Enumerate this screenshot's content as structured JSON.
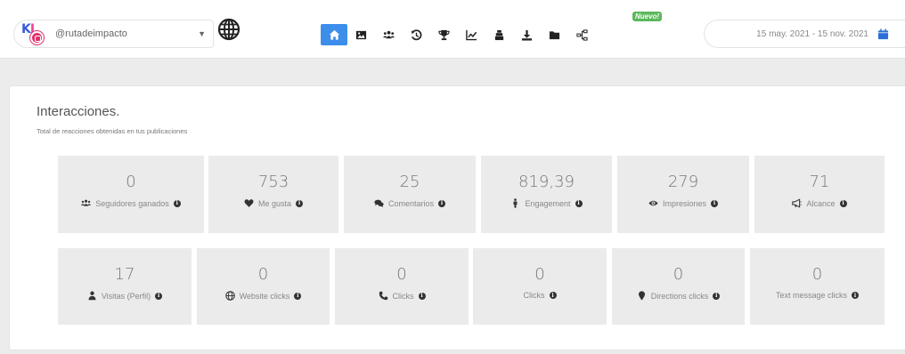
{
  "account": {
    "name": "@rutadeimpacto",
    "logo_text": "KI"
  },
  "nav": {
    "icons": [
      "home-icon",
      "image-icon",
      "users-icon",
      "history-icon",
      "trophy-icon",
      "chart-icon",
      "ranking-icon",
      "download-icon",
      "folder-icon",
      "network-icon"
    ],
    "new_badge": "Nuevo!"
  },
  "date_range": "15 may. 2021 - 15 nov. 2021",
  "section": {
    "title": "Interacciones.",
    "subtitle": "Total de reacciones obtenidas en tus publicaciones"
  },
  "metrics_row1": [
    {
      "value": "0",
      "label": "Seguidores ganados",
      "icon": "users-icon"
    },
    {
      "value": "753",
      "label": "Me gusta",
      "icon": "heart-icon"
    },
    {
      "value": "25",
      "label": "Comentarios",
      "icon": "comments-icon"
    },
    {
      "value": "819,39",
      "label": "Engagement",
      "icon": "male-icon"
    },
    {
      "value": "279",
      "label": "Impresiones",
      "icon": "eye-icon"
    },
    {
      "value": "71",
      "label": "Alcance",
      "icon": "megaphone-icon"
    }
  ],
  "metrics_row2": [
    {
      "value": "17",
      "label": "Visitas (Perfil)",
      "icon": "user-icon"
    },
    {
      "value": "0",
      "label": "Website clicks",
      "icon": "globe-icon"
    },
    {
      "value": "0",
      "label": "Clicks",
      "icon": "phone-icon"
    },
    {
      "value": "0",
      "label": "Clicks",
      "icon": ""
    },
    {
      "value": "0",
      "label": "Directions clicks",
      "icon": "map-marker-icon"
    },
    {
      "value": "0",
      "label": "Text message clicks",
      "icon": ""
    }
  ],
  "colors": {
    "accent": "#3d8eeb",
    "new_badge": "#5cb85c",
    "card_bg": "#ebebeb",
    "instagram": "#e1306c"
  }
}
